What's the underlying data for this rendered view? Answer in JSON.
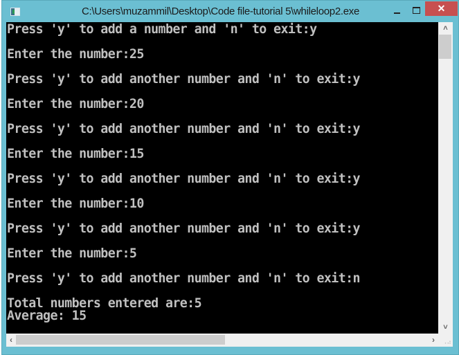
{
  "window": {
    "title": "C:\\Users\\muzammil\\Desktop\\Code file-tutorial 5\\whileloop2.exe",
    "icons": {
      "app": "console-app-icon",
      "minimize": "minimize-icon",
      "maximize": "maximize-icon",
      "close": "close-icon"
    },
    "close_glyph": "✕",
    "colors": {
      "frame": "#6bbfd2",
      "close": "#c75050",
      "console_bg": "#000000",
      "console_text": "#c0c0c0"
    }
  },
  "console": {
    "lines": [
      "Press 'y' to add a number and 'n' to exit:y",
      "Enter the number:25",
      "Press 'y' to add another number and 'n' to exit:y",
      "Enter the number:20",
      "Press 'y' to add another number and 'n' to exit:y",
      "Enter the number:15",
      "Press 'y' to add another number and 'n' to exit:y",
      "Enter the number:10",
      "Press 'y' to add another number and 'n' to exit:y",
      "Enter the number:5",
      "Press 'y' to add another number and 'n' to exit:n",
      "Total numbers entered are:5",
      "Average: 15"
    ]
  },
  "scrollbars": {
    "up_glyph": "˄",
    "down_glyph": "˅",
    "left_glyph": "‹",
    "right_glyph": "›"
  }
}
